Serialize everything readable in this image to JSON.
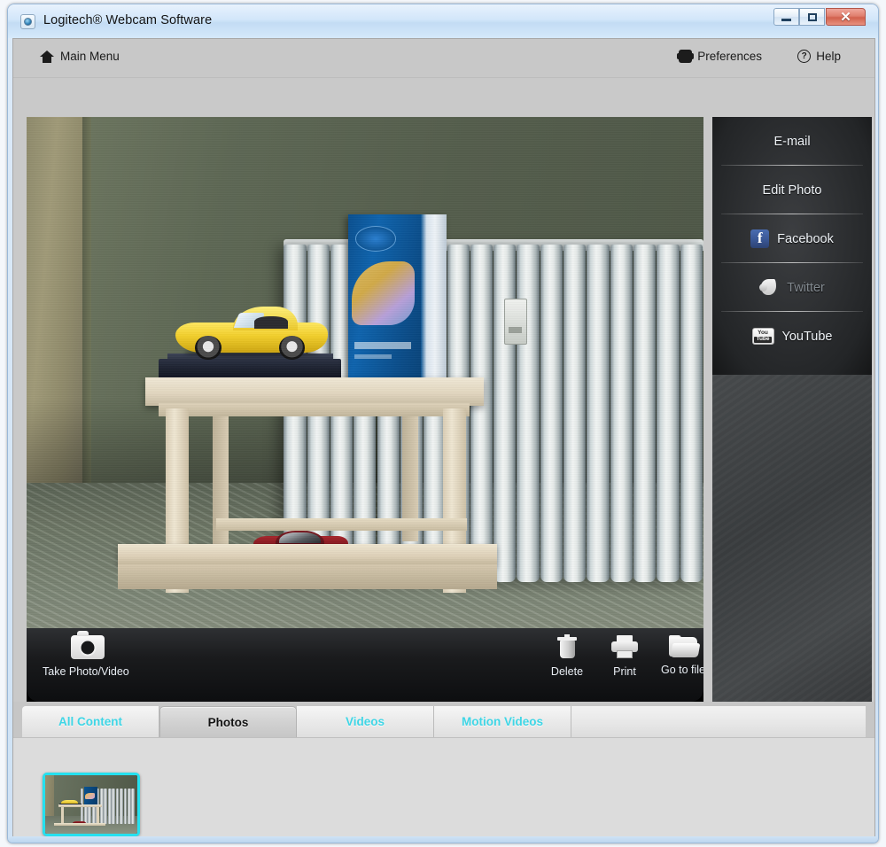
{
  "window": {
    "title": "Logitech® Webcam Software",
    "icon": "webcam-icon",
    "controls": {
      "minimize": "–",
      "maximize": "□",
      "close": "✕"
    }
  },
  "menu_bar": {
    "main_menu": "Main Menu",
    "main_menu_icon": "home-icon",
    "preferences": "Preferences",
    "preferences_icon": "gear-icon",
    "help": "Help",
    "help_icon": "question-circle-icon"
  },
  "photo_toolbar": {
    "take_photo": "Take Photo/Video",
    "take_photo_icon": "camera-icon",
    "delete": "Delete",
    "delete_icon": "trash-icon",
    "print": "Print",
    "print_icon": "printer-icon",
    "go_to_file": "Go to file",
    "go_to_file_icon": "folder-icon"
  },
  "side_panel": {
    "items": [
      {
        "label": "E-mail",
        "icon": "",
        "disabled": false
      },
      {
        "label": "Edit Photo",
        "icon": "",
        "disabled": false
      },
      {
        "label": "Facebook",
        "icon": "facebook-icon",
        "disabled": false
      },
      {
        "label": "Twitter",
        "icon": "twitter-icon",
        "disabled": true
      },
      {
        "label": "YouTube",
        "icon": "youtube-icon",
        "disabled": false
      }
    ],
    "facebook_glyph": "f",
    "youtube_you": "You",
    "youtube_tube": "Tube"
  },
  "tabs": [
    {
      "label": "All Content",
      "active": false
    },
    {
      "label": "Photos",
      "active": true
    },
    {
      "label": "Videos",
      "active": false
    },
    {
      "label": "Motion Videos",
      "active": false
    }
  ],
  "thumbnails": [
    {
      "name": "photo-thumbnail-1",
      "selected": true
    }
  ],
  "colors": {
    "accent_cyan": "#3fd6e6",
    "selection_border": "#25e0ef",
    "title_bar": "#cfe2f5",
    "chrome_grey": "#c8c8c8",
    "panel_dark": "#2c2e30",
    "close_button_red": "#d2604c"
  }
}
